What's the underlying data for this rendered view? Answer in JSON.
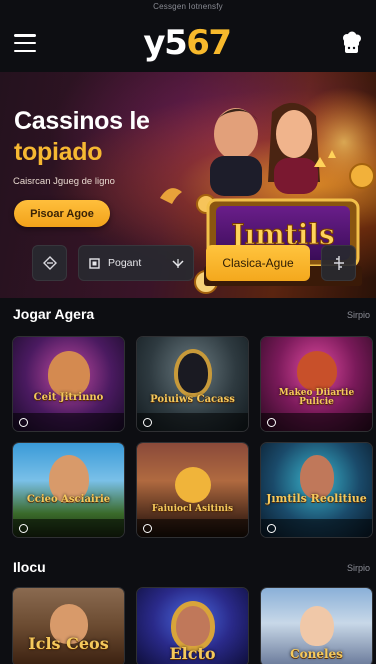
{
  "status_text": "Cessgen Iotnensfy",
  "brand": {
    "logo_white": "y5",
    "logo_yellow": "67"
  },
  "hero": {
    "title_line1": "Cassinos le",
    "title_line2": "topiado",
    "subtitle": "Caisrcan Jgueg de ligno",
    "cta_label": "Pisoar Agoe",
    "sign_text": "Jımtils"
  },
  "controls": {
    "dropdown_label": "Pogant",
    "primary_label": "Clasica-Ague"
  },
  "section1": {
    "title": "Jogar Agera",
    "more": "Sirpio",
    "games": [
      {
        "name": "Ceit Jitrinno",
        "badge": "0"
      },
      {
        "name": "Poiuiws Cacass",
        "badge": "0"
      },
      {
        "name": "Makeo Diiartie Pulicie",
        "badge": "0"
      },
      {
        "name": "Ccieo Asciairie",
        "badge": "0"
      },
      {
        "name": "Faiuiocl Asitinis",
        "badge": "0"
      },
      {
        "name": "Jımtils Reolitiue",
        "badge": "0"
      }
    ]
  },
  "section2": {
    "title": "Ilocu",
    "more": "Sirpio",
    "games": [
      {
        "name": "Icls Ceos"
      },
      {
        "name": "Elcto"
      },
      {
        "name": "Coneles"
      }
    ]
  },
  "colors": {
    "accent": "#f6b832",
    "background": "#0d0e12",
    "card": "#282930"
  },
  "icons": {
    "menu": "hamburger-icon",
    "user": "user-chef-icon",
    "control_a": "diamond-arrow-icon",
    "control_b": "square-icon",
    "control_b_chevron": "chevron-down-icon",
    "control_d": "plus-split-icon"
  }
}
